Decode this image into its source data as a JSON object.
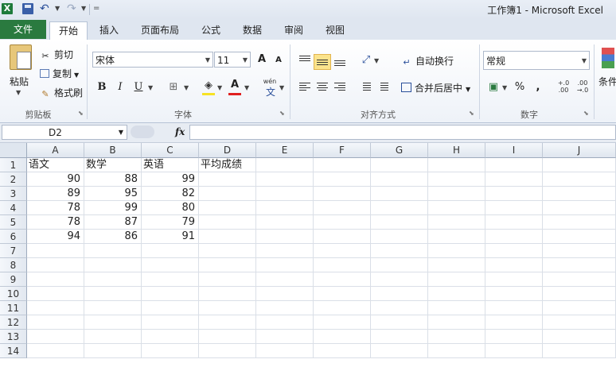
{
  "window": {
    "title": "工作簿1  -  Microsoft Excel"
  },
  "qat": {
    "logo": "X",
    "undo": "↶",
    "redo": "↷",
    "customize": "="
  },
  "tabs": [
    "文件",
    "开始",
    "插入",
    "页面布局",
    "公式",
    "数据",
    "审阅",
    "视图"
  ],
  "active_tab_index": 1,
  "clipboard": {
    "paste": "粘贴",
    "cut": "剪切",
    "copy": "复制",
    "format_painter": "格式刷",
    "group": "剪贴板"
  },
  "font": {
    "name": "宋体",
    "size": "11",
    "grow": "A",
    "shrink": "A",
    "bold": "B",
    "italic": "I",
    "underline": "U",
    "font_color": "A",
    "phonetic": "wén",
    "group": "字体",
    "font_color_value": "#e02020",
    "fill_color_value": "#f7e224"
  },
  "alignment": {
    "wrap": "自动换行",
    "merge": "合并后居中",
    "group": "对齐方式"
  },
  "number": {
    "format": "常规",
    "percent": "%",
    "comma": ",",
    "inc_decimal": "+.0 .00",
    "dec_decimal": ".00 →.0",
    "group": "数字"
  },
  "styles": {
    "conditional": "条件"
  },
  "formula_bar": {
    "name_box": "D2",
    "fx": "fx",
    "formula": ""
  },
  "columns": [
    "A",
    "B",
    "C",
    "D",
    "E",
    "F",
    "G",
    "H",
    "I",
    "J"
  ],
  "rows": [
    "1",
    "2",
    "3",
    "4",
    "5",
    "6",
    "7",
    "8",
    "9",
    "10",
    "11",
    "12",
    "13",
    "14"
  ],
  "sheet": {
    "headers": [
      "语文",
      "数学",
      "英语",
      "平均成绩"
    ],
    "data": [
      [
        "90",
        "88",
        "99"
      ],
      [
        "89",
        "95",
        "82"
      ],
      [
        "78",
        "99",
        "80"
      ],
      [
        "78",
        "87",
        "79"
      ],
      [
        "94",
        "86",
        "91"
      ]
    ]
  }
}
